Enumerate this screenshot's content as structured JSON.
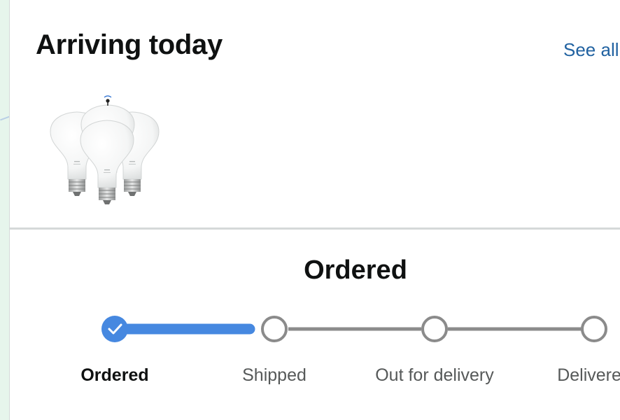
{
  "card": {
    "title": "Arriving today",
    "see_all_label": "See all"
  },
  "product": {
    "image_alt": "Smart LED flood light bulbs (3-pack)"
  },
  "progress": {
    "status_title": "Ordered",
    "current_step_index": 0,
    "steps": [
      {
        "label": "Ordered",
        "state": "complete"
      },
      {
        "label": "Shipped",
        "state": "pending"
      },
      {
        "label": "Out for delivery",
        "state": "pending"
      },
      {
        "label": "Delivered",
        "state": "pending"
      }
    ]
  },
  "colors": {
    "title_text": "#0f1111",
    "link": "#2162a1",
    "progress_active": "#4688e0",
    "progress_inactive": "#8b8b8b",
    "divider": "#d5d9d9",
    "page_background": "#e6f5ec"
  }
}
